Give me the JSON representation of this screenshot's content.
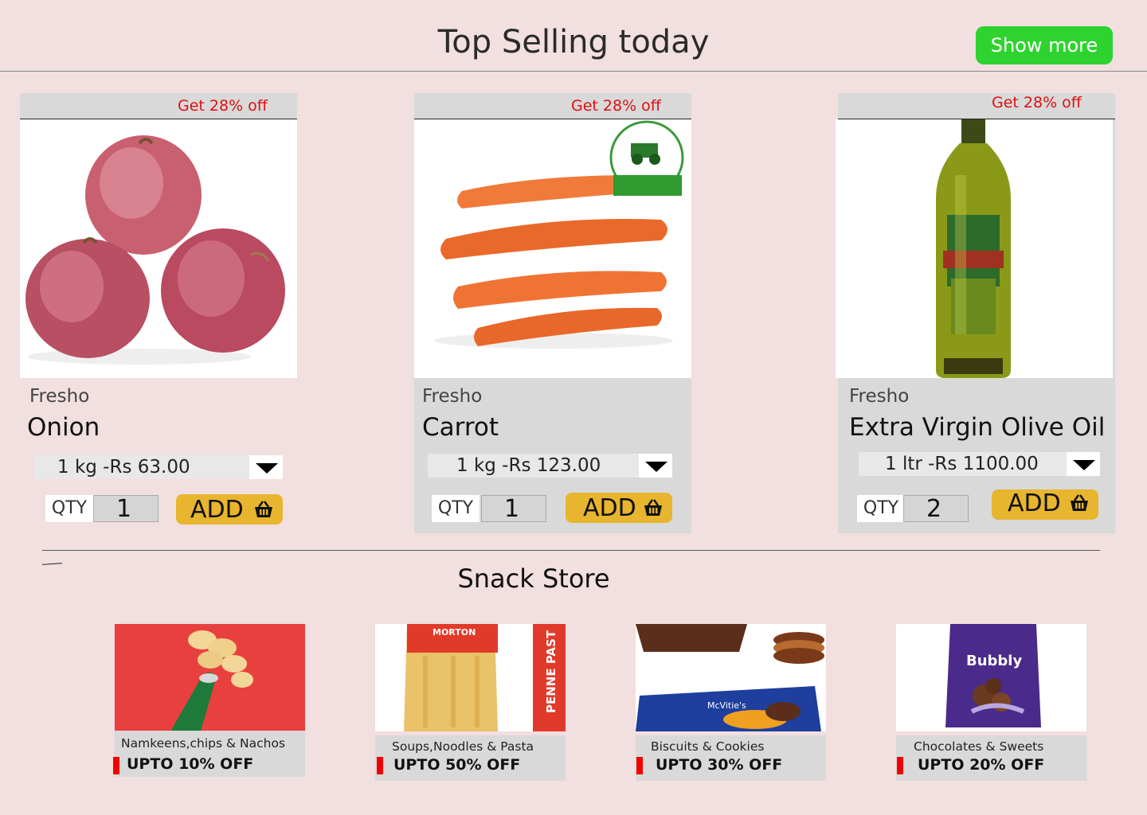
{
  "header": {
    "title": "Top Selling today",
    "show_more": "Show more"
  },
  "products": [
    {
      "offer": "Get 28% off",
      "brand": "Fresho",
      "name": "Onion",
      "variant": "1 kg -Rs 63.00",
      "qty_label": "QTY",
      "qty": "1",
      "add_label": "ADD",
      "image": "onion"
    },
    {
      "offer": "Get 28% off",
      "brand": "Fresho",
      "name": "Carrot",
      "variant": "1 kg -Rs 123.00",
      "qty_label": "QTY",
      "qty": "1",
      "add_label": "ADD",
      "image": "carrot"
    },
    {
      "offer": "Get 28% off",
      "brand": "Fresho",
      "name": "Extra Virgin Olive Oil",
      "variant": "1 ltr -Rs 1100.00",
      "qty_label": "QTY",
      "qty": "2",
      "add_label": "ADD",
      "image": "olive-oil"
    }
  ],
  "snack_store": {
    "title": "Snack Store",
    "items": [
      {
        "category": "Namkeens,chips & Nachos",
        "offer": "UPTO 10% OFF",
        "image": "pringles"
      },
      {
        "category": "Soups,Noodles & Pasta",
        "offer": "UPTO 50% OFF",
        "image": "penne-pasta",
        "image_text": "MORTON",
        "image_side_text": "PENNE PAST"
      },
      {
        "category": "Biscuits & Cookies",
        "offer": "UPTO 30% OFF",
        "image": "biscuits",
        "image_text": "McVitie's"
      },
      {
        "category": "Chocolates & Sweets",
        "offer": "UPTO 20% OFF",
        "image": "chocolates",
        "image_text": "Bubbly"
      }
    ]
  },
  "colors": {
    "background": "#f2dfdf",
    "show_more": "#2fd32f",
    "add": "#e8b52e",
    "offer_text": "#e01010",
    "card": "#d9d9d9"
  },
  "icons": {
    "add": "basket-icon",
    "dropdown": "chevron-down-icon"
  }
}
